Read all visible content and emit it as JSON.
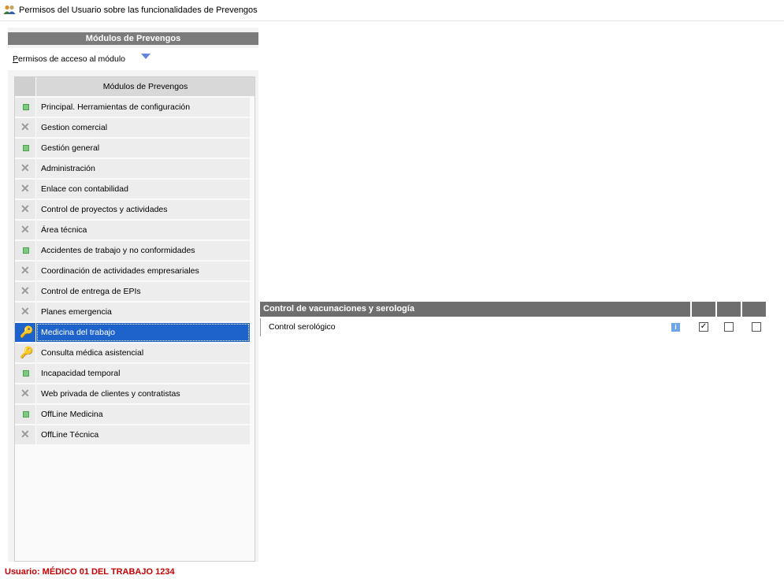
{
  "window": {
    "title": "Permisos del Usuario sobre las funcionalidades de Prevengos",
    "title_icon": "users-icon"
  },
  "left_panel": {
    "header": "Módulos de Prevengos",
    "permissions_dropdown": {
      "label": "Permisos de acceso al módulo",
      "icon": "triangle-down-icon"
    },
    "grid_header": "Módulos de Prevengos",
    "modules": [
      {
        "label": "Principal. Herramientas de configuración",
        "status": "green-square"
      },
      {
        "label": "Gestion comercial",
        "status": "x"
      },
      {
        "label": "Gestión general",
        "status": "green-square"
      },
      {
        "label": "Administración",
        "status": "x"
      },
      {
        "label": "Enlace con contabilidad",
        "status": "x"
      },
      {
        "label": "Control de proyectos y actividades",
        "status": "x"
      },
      {
        "label": "Área técnica",
        "status": "x"
      },
      {
        "label": "Accidentes de trabajo y no conformidades",
        "status": "green-square"
      },
      {
        "label": "Coordinación de actividades empresariales",
        "status": "x"
      },
      {
        "label": "Control de entrega de EPIs",
        "status": "x"
      },
      {
        "label": "Planes emergencia",
        "status": "x"
      },
      {
        "label": "Medicina del trabajo",
        "status": "key",
        "selected": true
      },
      {
        "label": "Consulta médica asistencial",
        "status": "key"
      },
      {
        "label": "Incapacidad temporal",
        "status": "green-square"
      },
      {
        "label": "Web privada de clientes y contratistas",
        "status": "x"
      },
      {
        "label": "OffLine Medicina",
        "status": "green-square"
      },
      {
        "label": "OffLine Técnica",
        "status": "x"
      }
    ]
  },
  "right_panel": {
    "section_title": "Control de vacunaciones y serología",
    "rows": [
      {
        "label": "Control serológico",
        "info_icon": "info-icon",
        "checkboxes": [
          true,
          false,
          false
        ]
      }
    ]
  },
  "footer": {
    "user_label": "Usuario: MÉDICO 01 DEL TRABAJO 1234"
  },
  "colors": {
    "selected_row": "#1e63cc",
    "user_text": "#c40000",
    "header_gray": "#7b7b7b"
  }
}
